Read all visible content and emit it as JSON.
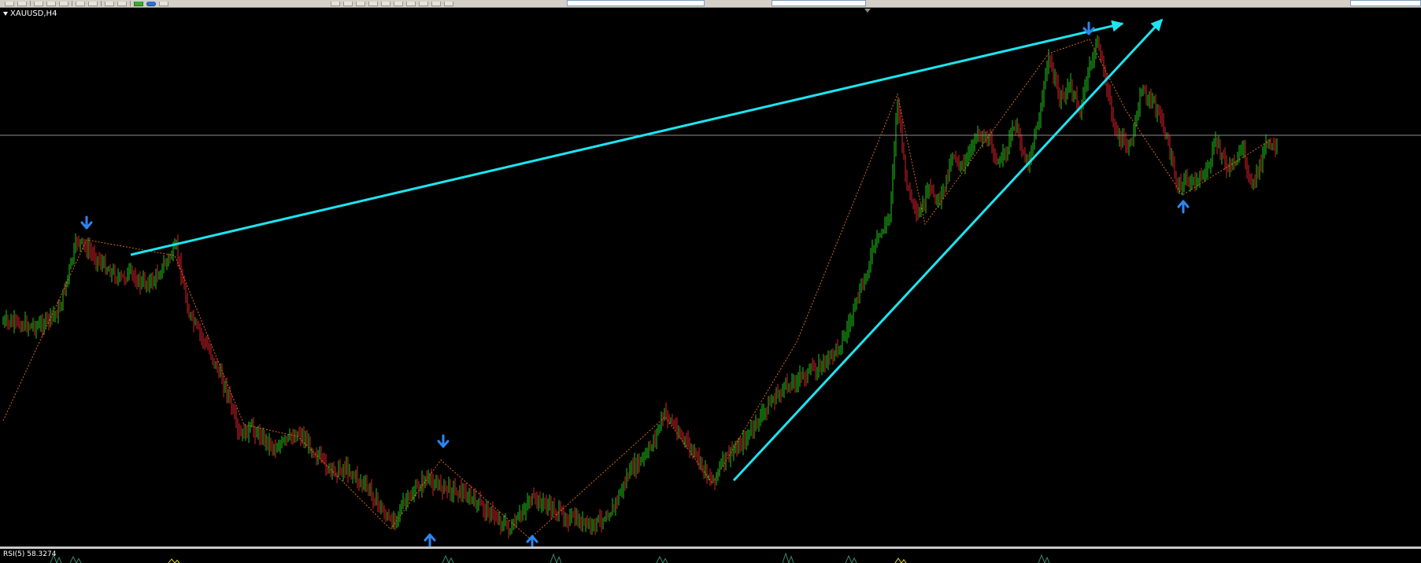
{
  "window": {
    "symbol_label": "XAUUSD,H4"
  },
  "indicator": {
    "label": "RSI(5) 58.3274"
  },
  "colors": {
    "bull": "#22c51a",
    "bear": "#d8202a",
    "trendline": "#1ee4f0",
    "signal_arrow": "#2d86f0",
    "zigzag": "#d46a1e",
    "price_line": "#8c8c8c",
    "rsi_line": "#e6df22"
  },
  "icons": {
    "sell_signal": "arrow-down-icon",
    "buy_signal": "arrow-up-icon",
    "menu": "triangle-down-icon"
  }
}
